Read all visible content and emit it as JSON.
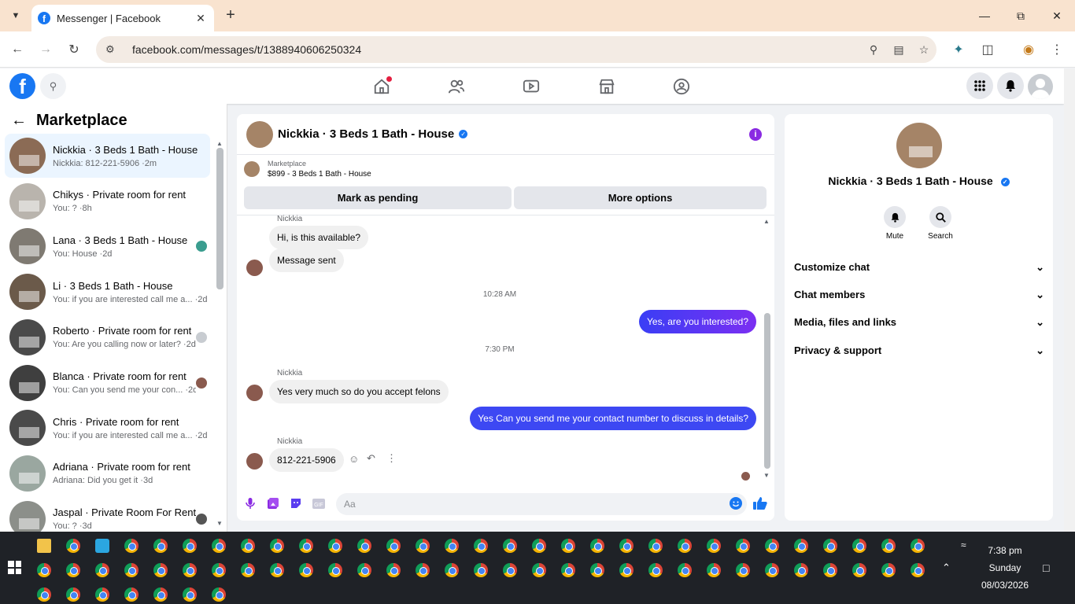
{
  "browser": {
    "tab_title": "Messenger | Facebook",
    "url": "facebook.com/messages/t/1388940606250324",
    "tab_bg": "#f9e3cf"
  },
  "fb": {
    "brand_color": "#1877f2",
    "notification_dot_color": "#e41e3f"
  },
  "left": {
    "header": "Marketplace",
    "conversations": [
      {
        "name": "Nickkia · 3 Beds 1 Bath - House",
        "preview": "Nickkia: 812-221-5906 ·2m",
        "active": true,
        "color": "#8b6b55"
      },
      {
        "name": "Chikys · Private room for rent",
        "preview": "You: ? ·8h",
        "active": false,
        "color": "#b9b4ad"
      },
      {
        "name": "Lana · 3 Beds 1 Bath - House",
        "preview": "You: House ·2d",
        "active": false,
        "color": "#7f7a72",
        "mini": "#3a9d8f"
      },
      {
        "name": "Li · 3 Beds 1 Bath - House",
        "preview": "You: if you are interested call me a... ·2d",
        "active": false,
        "color": "#6b5a4a"
      },
      {
        "name": "Roberto · Private room for rent",
        "preview": "You: Are you calling now or later? ·2d",
        "active": false,
        "color": "#4a4a4a",
        "mini": "#c8ccd1"
      },
      {
        "name": "Blanca · Private room for rent",
        "preview": "You: Can you send me your con... ·2d",
        "active": false,
        "color": "#3f3f3f",
        "mini": "#8a5a4e"
      },
      {
        "name": "Chris · Private room for rent",
        "preview": "You: if you are interested call me a... ·2d",
        "active": false,
        "color": "#4a4a4a"
      },
      {
        "name": "Adriana · Private room for rent",
        "preview": "Adriana: Did you get it ·3d",
        "active": false,
        "color": "#9aa7a0"
      },
      {
        "name": "Jaspal · Private Room For Rent",
        "preview": "You: ? ·3d",
        "active": false,
        "color": "#8c8f8a",
        "mini": "#555"
      }
    ]
  },
  "chat": {
    "title": "Nickkia · 3 Beds 1 Bath - House",
    "listing_source": "Marketplace",
    "listing_price": "$899 - 3 Beds 1 Bath - House",
    "mark_pending": "Mark as pending",
    "more_options": "More options",
    "sender": "Nickkia",
    "messages": {
      "m1": "Hi, is this available?",
      "m2": "Message sent",
      "ts1": "10:28 AM",
      "m3": "Yes, are you interested?",
      "ts2": "7:30 PM",
      "m4": "Yes very much so do you accept felons",
      "m5": "Yes Can you send me your contact number to discuss in details?",
      "m6": "812-221-5906"
    },
    "input_placeholder": "Aa",
    "accent": "#8a2be2"
  },
  "right": {
    "name": "Nickkia · 3 Beds 1 Bath - House",
    "mute": "Mute",
    "search": "Search",
    "sections": [
      "Customize chat",
      "Chat members",
      "Media, files and links",
      "Privacy & support"
    ]
  },
  "taskbar": {
    "time": "7:38 pm",
    "day": "Sunday",
    "date": "08/03/2026"
  }
}
